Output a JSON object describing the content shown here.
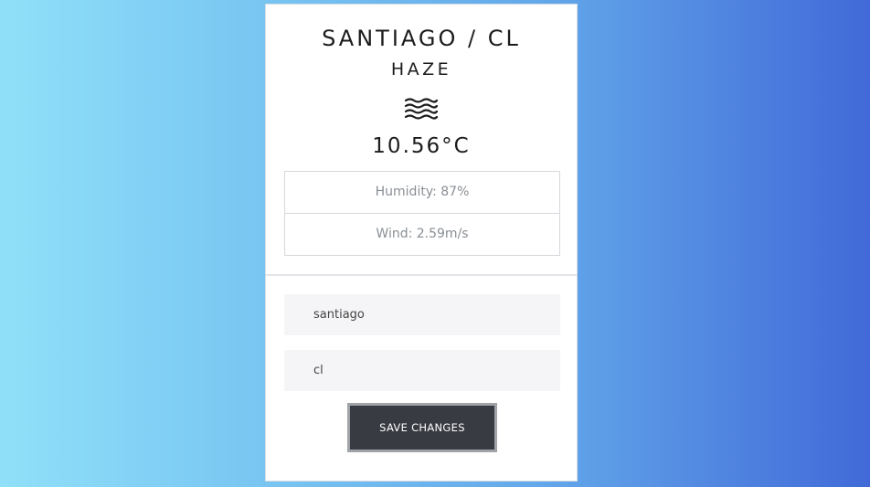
{
  "weather": {
    "location": "SANTIAGO / CL",
    "condition": "HAZE",
    "condition_icon": "haze-icon",
    "temperature": "10.56°C",
    "humidity": "Humidity: 87%",
    "wind": "Wind: 2.59m/s"
  },
  "form": {
    "city_value": "santiago",
    "country_value": "cl",
    "save_label": "SAVE CHANGES"
  },
  "colors": {
    "gradient_start": "#90e0f9",
    "gradient_end": "#416ad8",
    "button_bg": "#393b42"
  }
}
